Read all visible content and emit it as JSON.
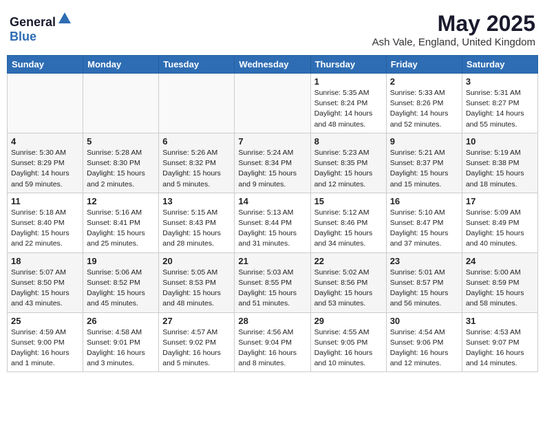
{
  "header": {
    "logo_general": "General",
    "logo_blue": "Blue",
    "month": "May 2025",
    "location": "Ash Vale, England, United Kingdom"
  },
  "weekdays": [
    "Sunday",
    "Monday",
    "Tuesday",
    "Wednesday",
    "Thursday",
    "Friday",
    "Saturday"
  ],
  "weeks": [
    [
      {
        "day": "",
        "sunrise": "",
        "sunset": "",
        "daylight": ""
      },
      {
        "day": "",
        "sunrise": "",
        "sunset": "",
        "daylight": ""
      },
      {
        "day": "",
        "sunrise": "",
        "sunset": "",
        "daylight": ""
      },
      {
        "day": "",
        "sunrise": "",
        "sunset": "",
        "daylight": ""
      },
      {
        "day": "1",
        "sunrise": "Sunrise: 5:35 AM",
        "sunset": "Sunset: 8:24 PM",
        "daylight": "Daylight: 14 hours and 48 minutes."
      },
      {
        "day": "2",
        "sunrise": "Sunrise: 5:33 AM",
        "sunset": "Sunset: 8:26 PM",
        "daylight": "Daylight: 14 hours and 52 minutes."
      },
      {
        "day": "3",
        "sunrise": "Sunrise: 5:31 AM",
        "sunset": "Sunset: 8:27 PM",
        "daylight": "Daylight: 14 hours and 55 minutes."
      }
    ],
    [
      {
        "day": "4",
        "sunrise": "Sunrise: 5:30 AM",
        "sunset": "Sunset: 8:29 PM",
        "daylight": "Daylight: 14 hours and 59 minutes."
      },
      {
        "day": "5",
        "sunrise": "Sunrise: 5:28 AM",
        "sunset": "Sunset: 8:30 PM",
        "daylight": "Daylight: 15 hours and 2 minutes."
      },
      {
        "day": "6",
        "sunrise": "Sunrise: 5:26 AM",
        "sunset": "Sunset: 8:32 PM",
        "daylight": "Daylight: 15 hours and 5 minutes."
      },
      {
        "day": "7",
        "sunrise": "Sunrise: 5:24 AM",
        "sunset": "Sunset: 8:34 PM",
        "daylight": "Daylight: 15 hours and 9 minutes."
      },
      {
        "day": "8",
        "sunrise": "Sunrise: 5:23 AM",
        "sunset": "Sunset: 8:35 PM",
        "daylight": "Daylight: 15 hours and 12 minutes."
      },
      {
        "day": "9",
        "sunrise": "Sunrise: 5:21 AM",
        "sunset": "Sunset: 8:37 PM",
        "daylight": "Daylight: 15 hours and 15 minutes."
      },
      {
        "day": "10",
        "sunrise": "Sunrise: 5:19 AM",
        "sunset": "Sunset: 8:38 PM",
        "daylight": "Daylight: 15 hours and 18 minutes."
      }
    ],
    [
      {
        "day": "11",
        "sunrise": "Sunrise: 5:18 AM",
        "sunset": "Sunset: 8:40 PM",
        "daylight": "Daylight: 15 hours and 22 minutes."
      },
      {
        "day": "12",
        "sunrise": "Sunrise: 5:16 AM",
        "sunset": "Sunset: 8:41 PM",
        "daylight": "Daylight: 15 hours and 25 minutes."
      },
      {
        "day": "13",
        "sunrise": "Sunrise: 5:15 AM",
        "sunset": "Sunset: 8:43 PM",
        "daylight": "Daylight: 15 hours and 28 minutes."
      },
      {
        "day": "14",
        "sunrise": "Sunrise: 5:13 AM",
        "sunset": "Sunset: 8:44 PM",
        "daylight": "Daylight: 15 hours and 31 minutes."
      },
      {
        "day": "15",
        "sunrise": "Sunrise: 5:12 AM",
        "sunset": "Sunset: 8:46 PM",
        "daylight": "Daylight: 15 hours and 34 minutes."
      },
      {
        "day": "16",
        "sunrise": "Sunrise: 5:10 AM",
        "sunset": "Sunset: 8:47 PM",
        "daylight": "Daylight: 15 hours and 37 minutes."
      },
      {
        "day": "17",
        "sunrise": "Sunrise: 5:09 AM",
        "sunset": "Sunset: 8:49 PM",
        "daylight": "Daylight: 15 hours and 40 minutes."
      }
    ],
    [
      {
        "day": "18",
        "sunrise": "Sunrise: 5:07 AM",
        "sunset": "Sunset: 8:50 PM",
        "daylight": "Daylight: 15 hours and 43 minutes."
      },
      {
        "day": "19",
        "sunrise": "Sunrise: 5:06 AM",
        "sunset": "Sunset: 8:52 PM",
        "daylight": "Daylight: 15 hours and 45 minutes."
      },
      {
        "day": "20",
        "sunrise": "Sunrise: 5:05 AM",
        "sunset": "Sunset: 8:53 PM",
        "daylight": "Daylight: 15 hours and 48 minutes."
      },
      {
        "day": "21",
        "sunrise": "Sunrise: 5:03 AM",
        "sunset": "Sunset: 8:55 PM",
        "daylight": "Daylight: 15 hours and 51 minutes."
      },
      {
        "day": "22",
        "sunrise": "Sunrise: 5:02 AM",
        "sunset": "Sunset: 8:56 PM",
        "daylight": "Daylight: 15 hours and 53 minutes."
      },
      {
        "day": "23",
        "sunrise": "Sunrise: 5:01 AM",
        "sunset": "Sunset: 8:57 PM",
        "daylight": "Daylight: 15 hours and 56 minutes."
      },
      {
        "day": "24",
        "sunrise": "Sunrise: 5:00 AM",
        "sunset": "Sunset: 8:59 PM",
        "daylight": "Daylight: 15 hours and 58 minutes."
      }
    ],
    [
      {
        "day": "25",
        "sunrise": "Sunrise: 4:59 AM",
        "sunset": "Sunset: 9:00 PM",
        "daylight": "Daylight: 16 hours and 1 minute."
      },
      {
        "day": "26",
        "sunrise": "Sunrise: 4:58 AM",
        "sunset": "Sunset: 9:01 PM",
        "daylight": "Daylight: 16 hours and 3 minutes."
      },
      {
        "day": "27",
        "sunrise": "Sunrise: 4:57 AM",
        "sunset": "Sunset: 9:02 PM",
        "daylight": "Daylight: 16 hours and 5 minutes."
      },
      {
        "day": "28",
        "sunrise": "Sunrise: 4:56 AM",
        "sunset": "Sunset: 9:04 PM",
        "daylight": "Daylight: 16 hours and 8 minutes."
      },
      {
        "day": "29",
        "sunrise": "Sunrise: 4:55 AM",
        "sunset": "Sunset: 9:05 PM",
        "daylight": "Daylight: 16 hours and 10 minutes."
      },
      {
        "day": "30",
        "sunrise": "Sunrise: 4:54 AM",
        "sunset": "Sunset: 9:06 PM",
        "daylight": "Daylight: 16 hours and 12 minutes."
      },
      {
        "day": "31",
        "sunrise": "Sunrise: 4:53 AM",
        "sunset": "Sunset: 9:07 PM",
        "daylight": "Daylight: 16 hours and 14 minutes."
      }
    ]
  ]
}
